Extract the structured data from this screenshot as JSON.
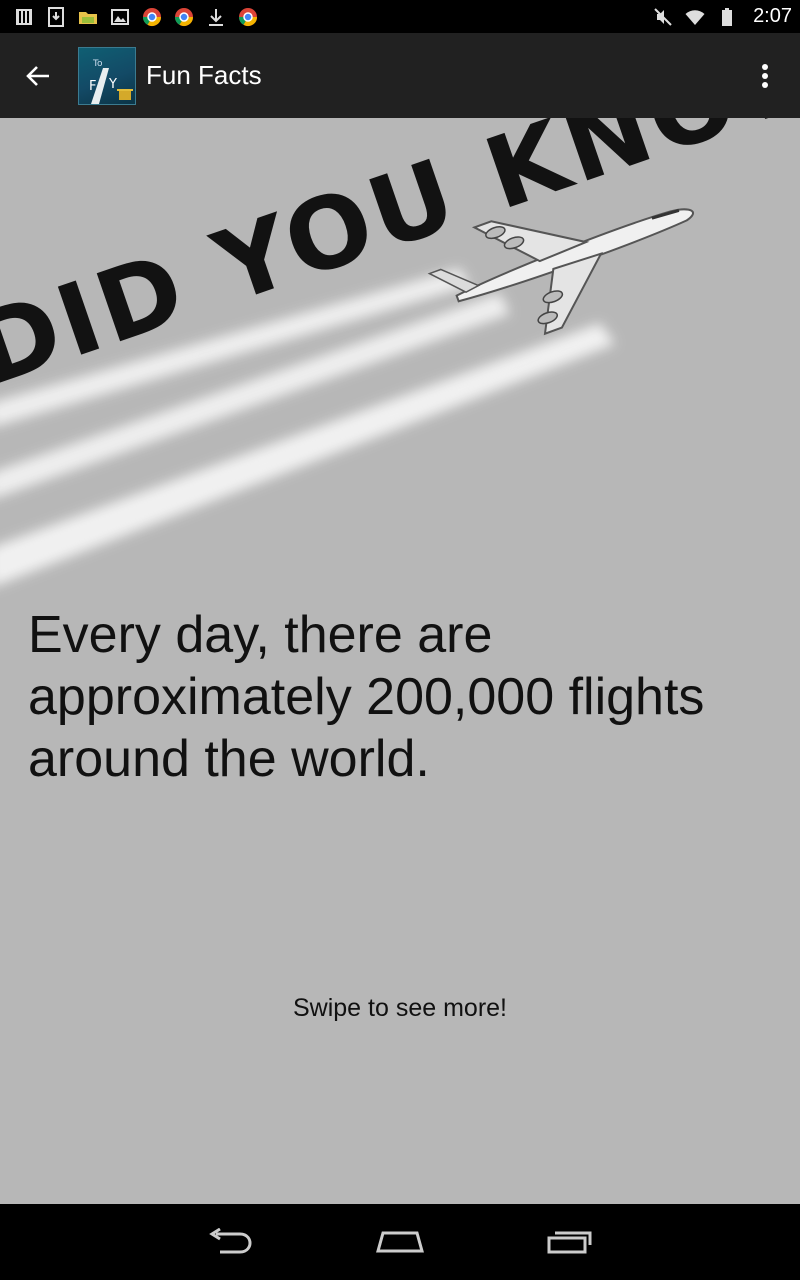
{
  "status_bar": {
    "time": "2:07",
    "left_icons": [
      "sim-card-icon",
      "download-app-icon",
      "folder-icon",
      "image-icon",
      "chrome-icon",
      "chrome-icon",
      "download-icon",
      "chrome-icon"
    ],
    "right_icons": [
      "mute-icon",
      "wifi-icon",
      "battery-icon"
    ]
  },
  "action_bar": {
    "title": "Fun Facts",
    "background": "#212121"
  },
  "hero": {
    "headline": "DID YOU KNOW..."
  },
  "fact": {
    "text": "Every day, there are approximately 200,000 flights around the world."
  },
  "swipe_hint": "Swipe to see more!",
  "colors": {
    "page_background": "#b7b7b7",
    "status_bar": "#000000",
    "nav_bar": "#000000"
  },
  "nav_bar": {
    "buttons": [
      "back-icon",
      "home-icon",
      "recents-icon"
    ]
  }
}
